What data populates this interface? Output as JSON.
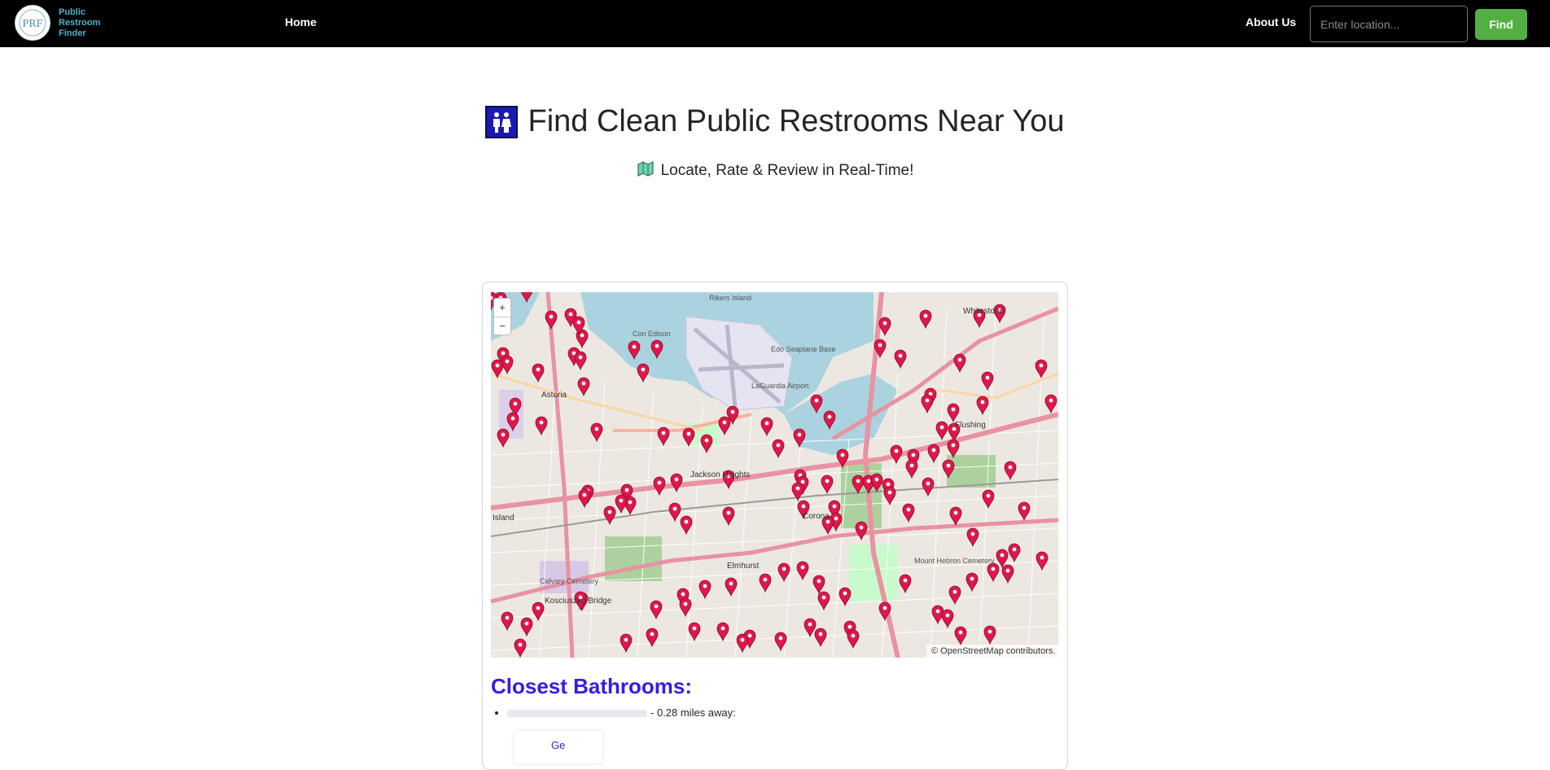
{
  "navbar": {
    "brand_lines": [
      "Public",
      "Restroom",
      "Finder"
    ],
    "logo_text": "PRF",
    "home_label": "Home",
    "about_label": "About Us",
    "search_placeholder": "Enter location...",
    "search_value": "",
    "find_label": "Find"
  },
  "hero": {
    "title": "Find Clean Public Restrooms Near You",
    "title_icon": "restroom-icon",
    "subtitle": "Locate, Rate & Review in Real-Time!",
    "subtitle_icon": "map-icon"
  },
  "map": {
    "zoom_in": "+",
    "zoom_out": "−",
    "attribution": "© OpenStreetMap contributors.",
    "marker_icon": "map-pin-icon",
    "marker_color": "#e0174a",
    "labels": {
      "rikers": "Rikers Island",
      "whitestone": "Whitestone",
      "astoria": "Astoria",
      "flushing": "Flushing",
      "jackson": "Jackson Heights",
      "corona": "Corona",
      "elmhurst": "Elmhurst",
      "kosciuszko": "Kosciuszko Bridge",
      "island": "Island",
      "con_edison": "Con Edison",
      "laguardia": "LaGuardia Airport",
      "seaplane": "Edo Seaplane Base",
      "calvary": "Calvary Cemetery",
      "mount_hebron": "Mount Hebron Cemetery"
    }
  },
  "results": {
    "title": "Closest Bathrooms:",
    "items": [
      {
        "distance_text": "- 0.28 miles away:"
      }
    ],
    "card_label": "Ge"
  },
  "colors": {
    "navbar_bg": "#000000",
    "brand": "#4fb3c8",
    "find_button": "#52b043",
    "results_title": "#3a1ae6"
  }
}
